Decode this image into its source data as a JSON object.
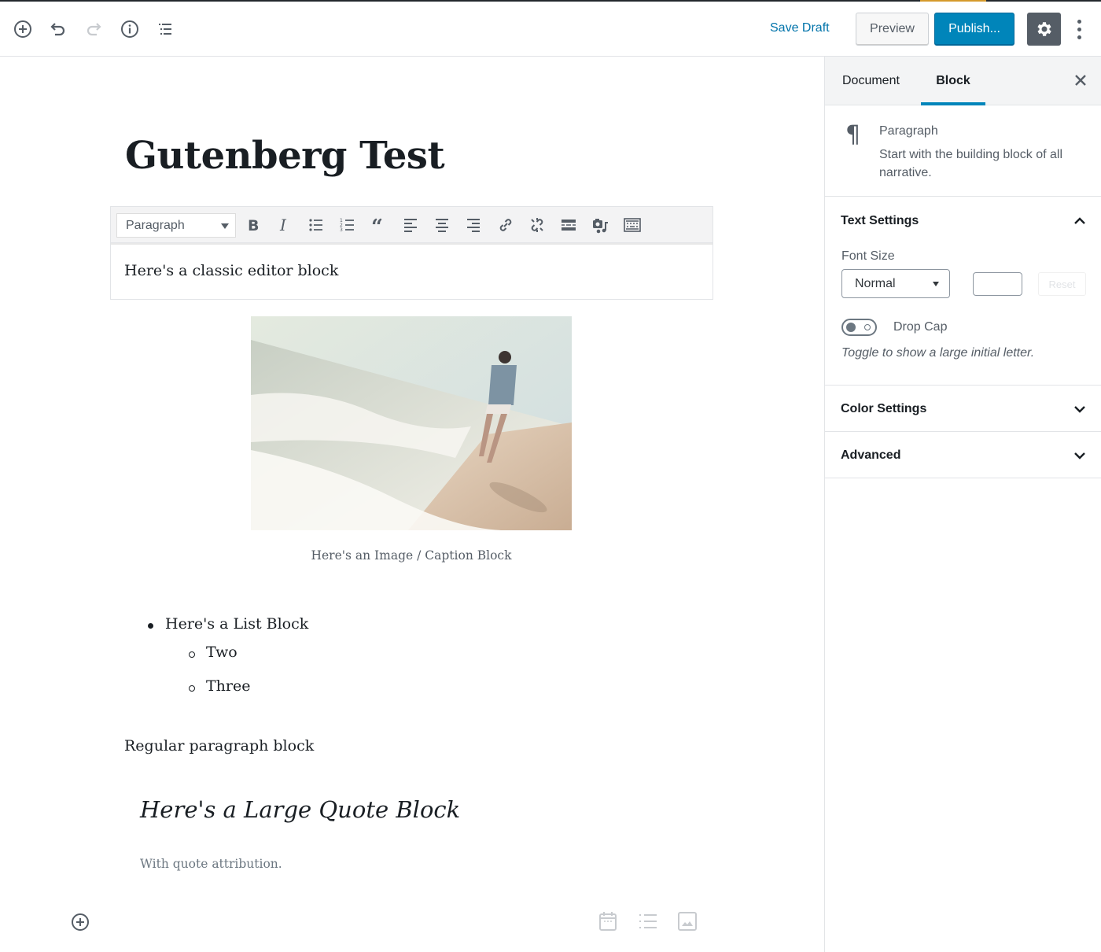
{
  "header": {
    "icons": {
      "add_block": "plus-circle-icon",
      "undo": "undo-icon",
      "redo": "redo-icon",
      "info": "info-icon",
      "outline": "list-outline-icon"
    },
    "save_draft_label": "Save Draft",
    "preview_label": "Preview",
    "publish_label": "Publish...",
    "settings_icon": "gear-icon",
    "more_icon": "vertical-ellipsis-icon",
    "colors": {
      "primary": "#0085ba",
      "link": "#0073aa",
      "settings_bg": "#555d66",
      "top_accent": "#d59a2c"
    }
  },
  "editor": {
    "post_title": "Gutenberg Test",
    "classic_block": {
      "format_select": "Paragraph",
      "toolbar_buttons": [
        "bold",
        "italic",
        "bulleted-list",
        "numbered-list",
        "blockquote",
        "align-left",
        "align-center",
        "align-right",
        "insert-link",
        "remove-link",
        "read-more",
        "add-media",
        "toolbar-toggle"
      ],
      "text": "Here's a classic editor block"
    },
    "image_block": {
      "alt": "Woman walking barefoot on a beach at the water's edge",
      "caption": "Here's an Image / Caption Block"
    },
    "list_block": {
      "items": [
        {
          "text": "Here's a List Block",
          "children": [
            "Two",
            "Three"
          ]
        }
      ]
    },
    "paragraph_block": "Regular paragraph block",
    "quote_block": {
      "text": "Here's a Large Quote Block",
      "citation": "With quote attribution."
    },
    "bottom_inserter": {
      "icons": [
        "plus-circle-icon",
        "calendar-icon",
        "list-icon",
        "image-icon"
      ]
    }
  },
  "sidebar": {
    "tabs": [
      {
        "label": "Document",
        "active": false
      },
      {
        "label": "Block",
        "active": true
      }
    ],
    "close_icon": "close-icon",
    "block_card": {
      "icon": "paragraph-icon",
      "title": "Paragraph",
      "description": "Start with the building block of all narrative."
    },
    "panels": {
      "text_settings": {
        "title": "Text Settings",
        "expanded": true,
        "font_size_label": "Font Size",
        "font_size_value": "Normal",
        "custom_size_value": "",
        "reset_label": "Reset",
        "drop_cap_label": "Drop Cap",
        "drop_cap_enabled": false,
        "drop_cap_help": "Toggle to show a large initial letter."
      },
      "color_settings": {
        "title": "Color Settings",
        "expanded": false
      },
      "advanced": {
        "title": "Advanced",
        "expanded": false
      }
    }
  }
}
